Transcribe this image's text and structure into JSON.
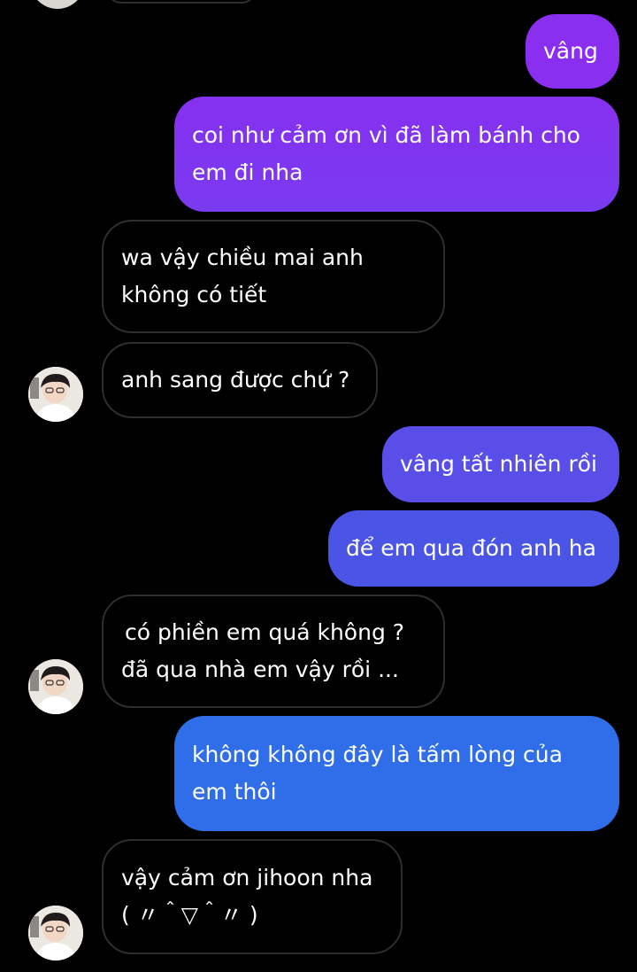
{
  "colors": {
    "background": "#000000",
    "incoming_bubble_border": "#2e2e2e",
    "outgoing_purple": "#8a2ff0",
    "outgoing_violet": "#7a3df0",
    "outgoing_indigo": "#5a4ee8",
    "outgoing_blue_violet": "#4a55e6",
    "outgoing_blue": "#2f6ee8",
    "text": "#ffffff"
  },
  "messages": [
    {
      "direction": "outgoing",
      "lines": [
        "vâng"
      ]
    },
    {
      "direction": "outgoing",
      "lines": [
        "coi như cảm ơn vì đã làm bánh cho",
        "em đi nha"
      ]
    },
    {
      "direction": "incoming",
      "lines": [
        "wa vậy chiều mai anh",
        "không có tiết"
      ]
    },
    {
      "direction": "incoming",
      "lines": [
        "anh sang được chứ ?"
      ],
      "avatar": "user-avatar"
    },
    {
      "direction": "outgoing",
      "lines": [
        "vâng tất nhiên rồi"
      ]
    },
    {
      "direction": "outgoing",
      "lines": [
        "để em qua đón anh ha"
      ]
    },
    {
      "direction": "incoming",
      "lines": [
        "có phiền em quá không ?",
        "đã qua nhà em vậy rồi ..."
      ],
      "avatar": "user-avatar"
    },
    {
      "direction": "outgoing",
      "lines": [
        "không không đây là tấm lòng của",
        "em thôi"
      ]
    },
    {
      "direction": "incoming",
      "lines": [
        "vậy cảm ơn jihoon nha",
        "( 〃＾▽＾〃 )"
      ],
      "avatar": "user-avatar"
    }
  ]
}
